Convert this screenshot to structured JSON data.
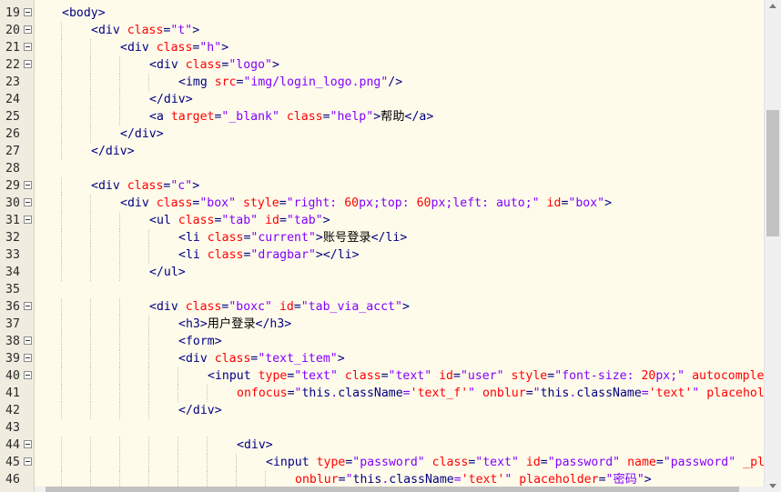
{
  "editor": {
    "lines": [
      {
        "num": "19",
        "fold": true,
        "guides": 0,
        "tokens": [
          [
            "tag",
            "<body>"
          ]
        ]
      },
      {
        "num": "20",
        "fold": true,
        "guides": 1,
        "tokens": [
          [
            "tag",
            "<div "
          ],
          [
            "attr",
            "class"
          ],
          [
            "tag",
            "="
          ],
          [
            "val",
            "\"t\""
          ],
          [
            "tag",
            ">"
          ]
        ]
      },
      {
        "num": "21",
        "fold": true,
        "guides": 2,
        "tokens": [
          [
            "tag",
            "<div "
          ],
          [
            "attr",
            "class"
          ],
          [
            "tag",
            "="
          ],
          [
            "val",
            "\"h\""
          ],
          [
            "tag",
            ">"
          ]
        ]
      },
      {
        "num": "22",
        "fold": true,
        "guides": 3,
        "tokens": [
          [
            "tag",
            "<div "
          ],
          [
            "attr",
            "class"
          ],
          [
            "tag",
            "="
          ],
          [
            "val",
            "\"logo\""
          ],
          [
            "tag",
            ">"
          ]
        ]
      },
      {
        "num": "23",
        "fold": false,
        "guides": 4,
        "tokens": [
          [
            "tag",
            "<img "
          ],
          [
            "attr",
            "src"
          ],
          [
            "tag",
            "="
          ],
          [
            "val",
            "\"img/login_logo.png\""
          ],
          [
            "tag",
            "/>"
          ]
        ]
      },
      {
        "num": "24",
        "fold": false,
        "guides": 3,
        "tokens": [
          [
            "tag",
            "</div>"
          ]
        ]
      },
      {
        "num": "25",
        "fold": false,
        "guides": 3,
        "tokens": [
          [
            "tag",
            "<a "
          ],
          [
            "attr",
            "target"
          ],
          [
            "tag",
            "="
          ],
          [
            "val",
            "\"_blank\" "
          ],
          [
            "attr",
            "class"
          ],
          [
            "tag",
            "="
          ],
          [
            "val",
            "\"help\""
          ],
          [
            "tag",
            ">"
          ],
          [
            "txt",
            "帮助"
          ],
          [
            "tag",
            "</a>"
          ]
        ]
      },
      {
        "num": "26",
        "fold": false,
        "guides": 2,
        "tokens": [
          [
            "tag",
            "</div>"
          ]
        ]
      },
      {
        "num": "27",
        "fold": false,
        "guides": 1,
        "tokens": [
          [
            "tag",
            "</div>"
          ]
        ]
      },
      {
        "num": "28",
        "fold": false,
        "guides": 0,
        "tokens": []
      },
      {
        "num": "29",
        "fold": true,
        "guides": 1,
        "tokens": [
          [
            "tag",
            "<div "
          ],
          [
            "attr",
            "class"
          ],
          [
            "tag",
            "="
          ],
          [
            "val",
            "\"c\""
          ],
          [
            "tag",
            ">"
          ]
        ]
      },
      {
        "num": "30",
        "fold": true,
        "guides": 2,
        "tokens": [
          [
            "tag",
            "<div "
          ],
          [
            "attr",
            "class"
          ],
          [
            "tag",
            "="
          ],
          [
            "val",
            "\"box\" "
          ],
          [
            "attr",
            "style"
          ],
          [
            "tag",
            "="
          ],
          [
            "val",
            "\"right: "
          ],
          [
            "attr",
            "60"
          ],
          [
            "val",
            "px;top: "
          ],
          [
            "attr",
            "60"
          ],
          [
            "val",
            "px;left: auto;\" "
          ],
          [
            "attr",
            "id"
          ],
          [
            "tag",
            "="
          ],
          [
            "val",
            "\"box\""
          ],
          [
            "tag",
            ">"
          ]
        ]
      },
      {
        "num": "31",
        "fold": true,
        "guides": 3,
        "tokens": [
          [
            "tag",
            "<ul "
          ],
          [
            "attr",
            "class"
          ],
          [
            "tag",
            "="
          ],
          [
            "val",
            "\"tab\" "
          ],
          [
            "attr",
            "id"
          ],
          [
            "tag",
            "="
          ],
          [
            "val",
            "\"tab\""
          ],
          [
            "tag",
            ">"
          ]
        ]
      },
      {
        "num": "32",
        "fold": false,
        "guides": 4,
        "tokens": [
          [
            "tag",
            "<li "
          ],
          [
            "attr",
            "class"
          ],
          [
            "tag",
            "="
          ],
          [
            "val",
            "\"current\""
          ],
          [
            "tag",
            ">"
          ],
          [
            "txt",
            "账号登录"
          ],
          [
            "tag",
            "</li>"
          ]
        ]
      },
      {
        "num": "33",
        "fold": false,
        "guides": 4,
        "tokens": [
          [
            "tag",
            "<li "
          ],
          [
            "attr",
            "class"
          ],
          [
            "tag",
            "="
          ],
          [
            "val",
            "\"dragbar\""
          ],
          [
            "tag",
            "></li>"
          ]
        ]
      },
      {
        "num": "34",
        "fold": false,
        "guides": 3,
        "tokens": [
          [
            "tag",
            "</ul>"
          ]
        ]
      },
      {
        "num": "35",
        "fold": false,
        "guides": 0,
        "tokens": []
      },
      {
        "num": "36",
        "fold": true,
        "guides": 3,
        "tokens": [
          [
            "tag",
            "<div "
          ],
          [
            "attr",
            "class"
          ],
          [
            "tag",
            "="
          ],
          [
            "val",
            "\"boxc\" "
          ],
          [
            "attr",
            "id"
          ],
          [
            "tag",
            "="
          ],
          [
            "val",
            "\"tab_via_acct\""
          ],
          [
            "tag",
            ">"
          ]
        ]
      },
      {
        "num": "37",
        "fold": false,
        "guides": 4,
        "tokens": [
          [
            "tag",
            "<h3>"
          ],
          [
            "txt",
            "用户登录"
          ],
          [
            "tag",
            "</h3>"
          ]
        ]
      },
      {
        "num": "38",
        "fold": true,
        "guides": 4,
        "tokens": [
          [
            "tag",
            "<form>"
          ]
        ]
      },
      {
        "num": "39",
        "fold": true,
        "guides": 4,
        "tokens": [
          [
            "tag",
            "<div "
          ],
          [
            "attr",
            "class"
          ],
          [
            "tag",
            "="
          ],
          [
            "val",
            "\"text_item\""
          ],
          [
            "tag",
            ">"
          ]
        ]
      },
      {
        "num": "40",
        "fold": true,
        "guides": 5,
        "tokens": [
          [
            "tag",
            "<input "
          ],
          [
            "attr",
            "type"
          ],
          [
            "tag",
            "="
          ],
          [
            "val",
            "\"text\" "
          ],
          [
            "attr",
            "class"
          ],
          [
            "tag",
            "="
          ],
          [
            "val",
            "\"text\" "
          ],
          [
            "attr",
            "id"
          ],
          [
            "tag",
            "="
          ],
          [
            "val",
            "\"user\" "
          ],
          [
            "attr",
            "style"
          ],
          [
            "tag",
            "="
          ],
          [
            "val",
            "\"font-size: "
          ],
          [
            "attr",
            "20"
          ],
          [
            "val",
            "px;\" "
          ],
          [
            "attr",
            "autocomple"
          ]
        ]
      },
      {
        "num": "41",
        "fold": false,
        "guides": 6,
        "tokens": [
          [
            "attr",
            "onfocus"
          ],
          [
            "tag",
            "="
          ],
          [
            "val",
            "\""
          ],
          [
            "tag",
            "this"
          ],
          [
            "val",
            "."
          ],
          [
            "tag",
            "className"
          ],
          [
            "val",
            "="
          ],
          [
            "attr",
            "'text_f'"
          ],
          [
            "val",
            "\" "
          ],
          [
            "attr",
            "onblur"
          ],
          [
            "tag",
            "="
          ],
          [
            "val",
            "\""
          ],
          [
            "tag",
            "this"
          ],
          [
            "val",
            "."
          ],
          [
            "tag",
            "className"
          ],
          [
            "val",
            "="
          ],
          [
            "attr",
            "'text'"
          ],
          [
            "val",
            "\" "
          ],
          [
            "attr",
            "placehol"
          ]
        ]
      },
      {
        "num": "42",
        "fold": false,
        "guides": 4,
        "tokens": [
          [
            "tag",
            "</div>"
          ]
        ]
      },
      {
        "num": "43",
        "fold": false,
        "guides": 0,
        "tokens": []
      },
      {
        "num": "44",
        "fold": true,
        "guides": 6,
        "tokens": [
          [
            "tag",
            "<div>"
          ]
        ]
      },
      {
        "num": "45",
        "fold": true,
        "guides": 7,
        "tokens": [
          [
            "tag",
            "<input "
          ],
          [
            "attr",
            "type"
          ],
          [
            "tag",
            "="
          ],
          [
            "val",
            "\"password\" "
          ],
          [
            "attr",
            "class"
          ],
          [
            "tag",
            "="
          ],
          [
            "val",
            "\"text\" "
          ],
          [
            "attr",
            "id"
          ],
          [
            "tag",
            "="
          ],
          [
            "val",
            "\"password\" "
          ],
          [
            "attr",
            "name"
          ],
          [
            "tag",
            "="
          ],
          [
            "val",
            "\"password\" "
          ],
          [
            "attr",
            "_pl"
          ]
        ]
      },
      {
        "num": "46",
        "fold": false,
        "guides": 8,
        "tokens": [
          [
            "attr",
            "onblur"
          ],
          [
            "tag",
            "="
          ],
          [
            "val",
            "\""
          ],
          [
            "tag",
            "this"
          ],
          [
            "val",
            "."
          ],
          [
            "tag",
            "className"
          ],
          [
            "val",
            "="
          ],
          [
            "attr",
            "'text'"
          ],
          [
            "val",
            "\" "
          ],
          [
            "attr",
            "placeholder"
          ],
          [
            "tag",
            "="
          ],
          [
            "val",
            "\"密码\""
          ],
          [
            "tag",
            ">"
          ]
        ]
      }
    ],
    "scrollbar_v": {
      "position": 0.21,
      "size": 0.27
    },
    "scrollbar_h": {
      "position": 0.015,
      "size": 0.95
    },
    "colors": {
      "background": "#fffbeb",
      "tag": "#000080",
      "attribute": "#ff0000",
      "value": "#8000ff",
      "text": "#000000"
    }
  }
}
